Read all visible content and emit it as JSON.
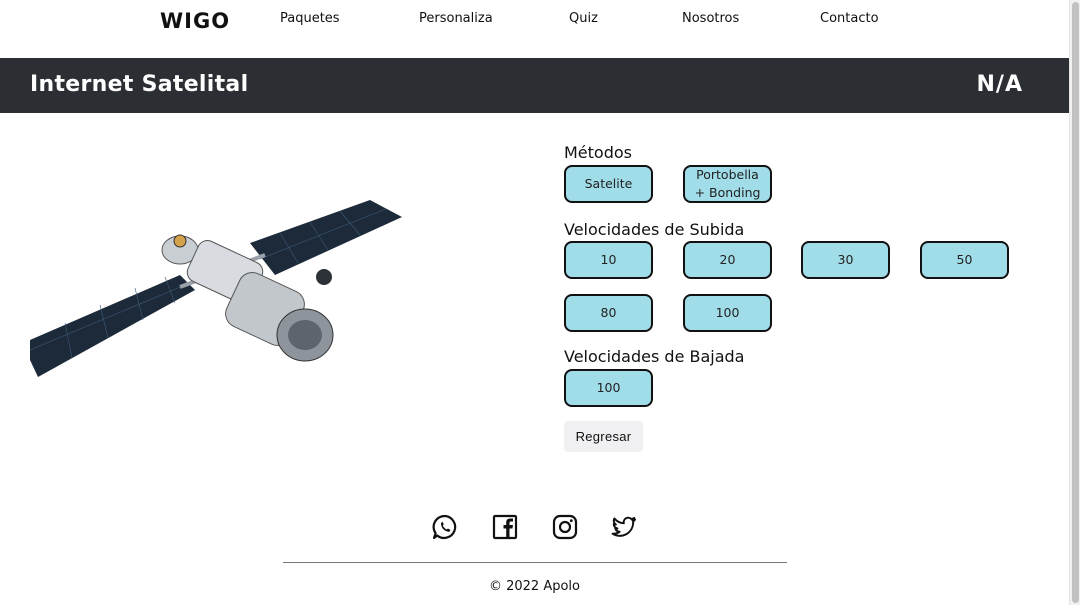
{
  "nav": {
    "logo": "WIGO",
    "links": [
      "Paquetes",
      "Personaliza",
      "Quiz",
      "Nosotros",
      "Contacto"
    ]
  },
  "banner": {
    "title": "Internet Satelital",
    "right_text": "N/A"
  },
  "metodos": {
    "label": "Métodos",
    "options": [
      "Satelite",
      "Portobella + Bonding"
    ]
  },
  "subida": {
    "label": "Velocidades de Subida",
    "options": [
      "10",
      "20",
      "30",
      "50",
      "80",
      "100"
    ]
  },
  "bajada": {
    "label": "Velocidades de Bajada",
    "options": [
      "100"
    ]
  },
  "back_button": "Regresar",
  "footer": {
    "social_icons": [
      "whatsapp-icon",
      "facebook-icon",
      "instagram-icon",
      "twitter-icon"
    ],
    "copyright": "© 2022 Apolo"
  },
  "colors": {
    "banner_bg": "#2b2e33",
    "option_bg": "#a0dde9",
    "button_bg": "#f0f0f2"
  }
}
